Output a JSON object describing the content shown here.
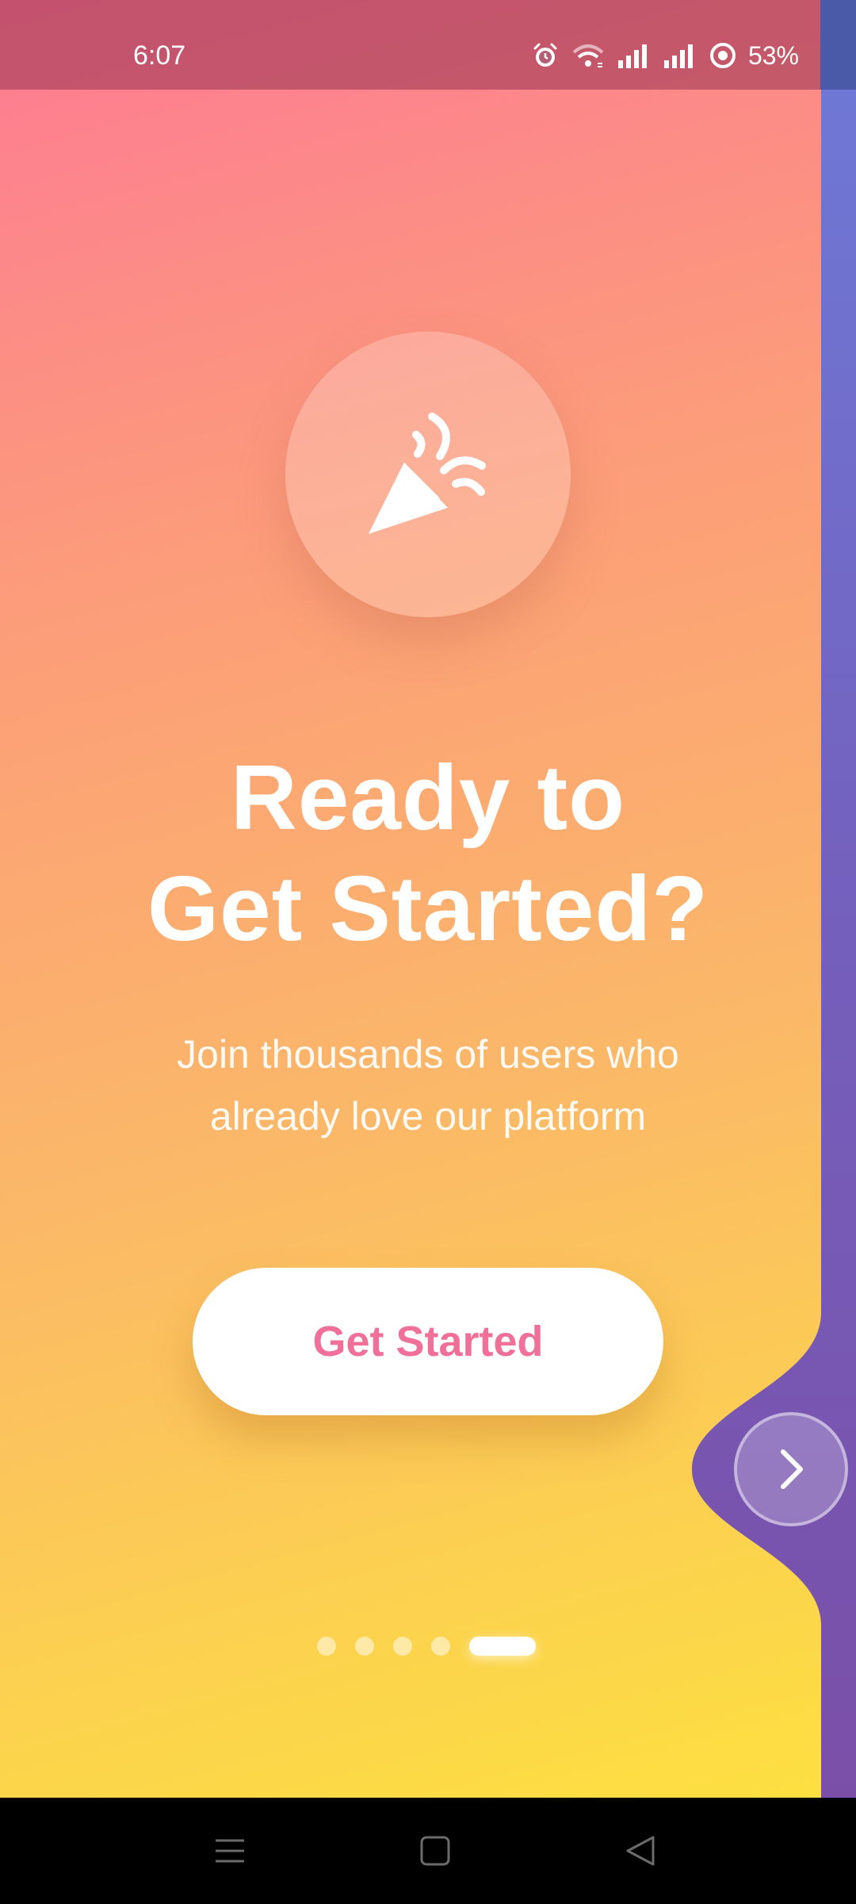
{
  "status_bar": {
    "time": "6:07",
    "battery_percent": "53%",
    "icons": [
      "alarm-icon",
      "wifi-icon",
      "signal-icon",
      "signal-icon",
      "battery-icon"
    ]
  },
  "onboarding": {
    "hero_icon": "party-popper-icon",
    "title_line1": "Ready to",
    "title_line2": "Get Started?",
    "subtitle_line1": "Join thousands of users who",
    "subtitle_line2": "already love our platform",
    "cta_label": "Get Started",
    "page_count": 5,
    "active_page": 5,
    "next_icon": "chevron-right-icon"
  },
  "colors": {
    "gradient_top": "#fd7a94",
    "gradient_bottom": "#fde040",
    "accent_purple": "#7a52b0",
    "cta_text": "#f0709a"
  },
  "nav_bar": {
    "icons": [
      "menu-icon",
      "home-icon",
      "back-icon"
    ]
  }
}
